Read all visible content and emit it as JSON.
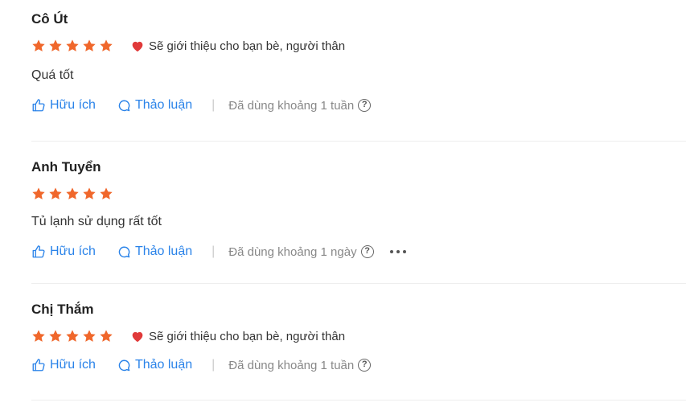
{
  "colors": {
    "star": "#f0672b",
    "heart": "#e03a3a",
    "link": "#2a83e9",
    "muted": "#888888"
  },
  "icons": {
    "star": "star-icon",
    "heart": "heart-icon",
    "like": "thumbs-up-icon",
    "discuss": "chat-bubble-icon",
    "help": "question-circle-icon",
    "more": "more-options-icon"
  },
  "reviews": [
    {
      "name": "Cô Út",
      "stars": 5,
      "recommend_text": "Sẽ giới thiệu cho bạn bè, người thân",
      "content": "Quá tốt",
      "helpful_label": "Hữu ích",
      "discuss_label": "Thảo luận",
      "usage_text": "Đã dùng khoảng 1 tuần"
    },
    {
      "name": "Anh Tuyển",
      "stars": 5,
      "recommend_text": "",
      "content": "Tủ lạnh sử dụng rất tốt",
      "helpful_label": "Hữu ích",
      "discuss_label": "Thảo luận",
      "usage_text": "Đã dùng khoảng 1 ngày"
    },
    {
      "name": "Chị Thắm",
      "stars": 5,
      "recommend_text": "Sẽ giới thiệu cho bạn bè, người thân",
      "content": "",
      "helpful_label": "Hữu ích",
      "discuss_label": "Thảo luận",
      "usage_text": "Đã dùng khoảng 1 tuần"
    }
  ]
}
